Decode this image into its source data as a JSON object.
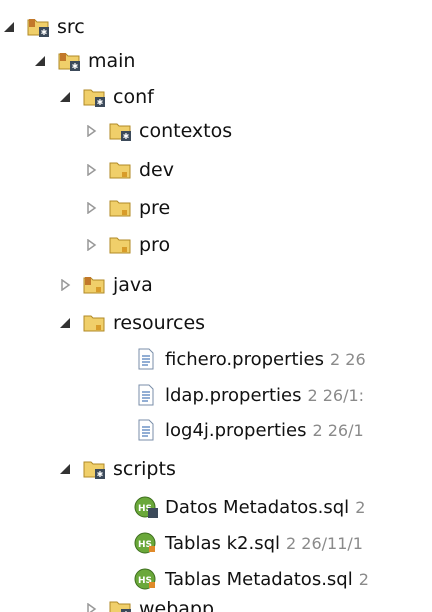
{
  "tree": {
    "src": "src",
    "main": "main",
    "conf": "conf",
    "contextos": "contextos",
    "dev": "dev",
    "pre": "pre",
    "pro": "pro",
    "java": "java",
    "resources": "resources",
    "fichero": {
      "name": "fichero.properties",
      "suffix": "2  26"
    },
    "ldap": {
      "name": "ldap.properties",
      "suffix": "2  26/1:"
    },
    "log4j": {
      "name": "log4j.properties",
      "suffix": "2  26/1"
    },
    "scripts": "scripts",
    "datos_sql": {
      "name": "Datos Metadatos.sql",
      "suffix": "2"
    },
    "tablas_k2_sql": {
      "name": "Tablas k2.sql",
      "suffix": "2  26/11/1"
    },
    "tablas_meta_sql": {
      "name": "Tablas Metadatos.sql",
      "suffix": "2"
    },
    "webapp": "webapp"
  },
  "icons": {
    "folder_color": "#e8c35a",
    "folder_edge": "#b08a26",
    "sql_icon_color": "#6aa83a",
    "properties_icon_color": "#4a78b8"
  }
}
